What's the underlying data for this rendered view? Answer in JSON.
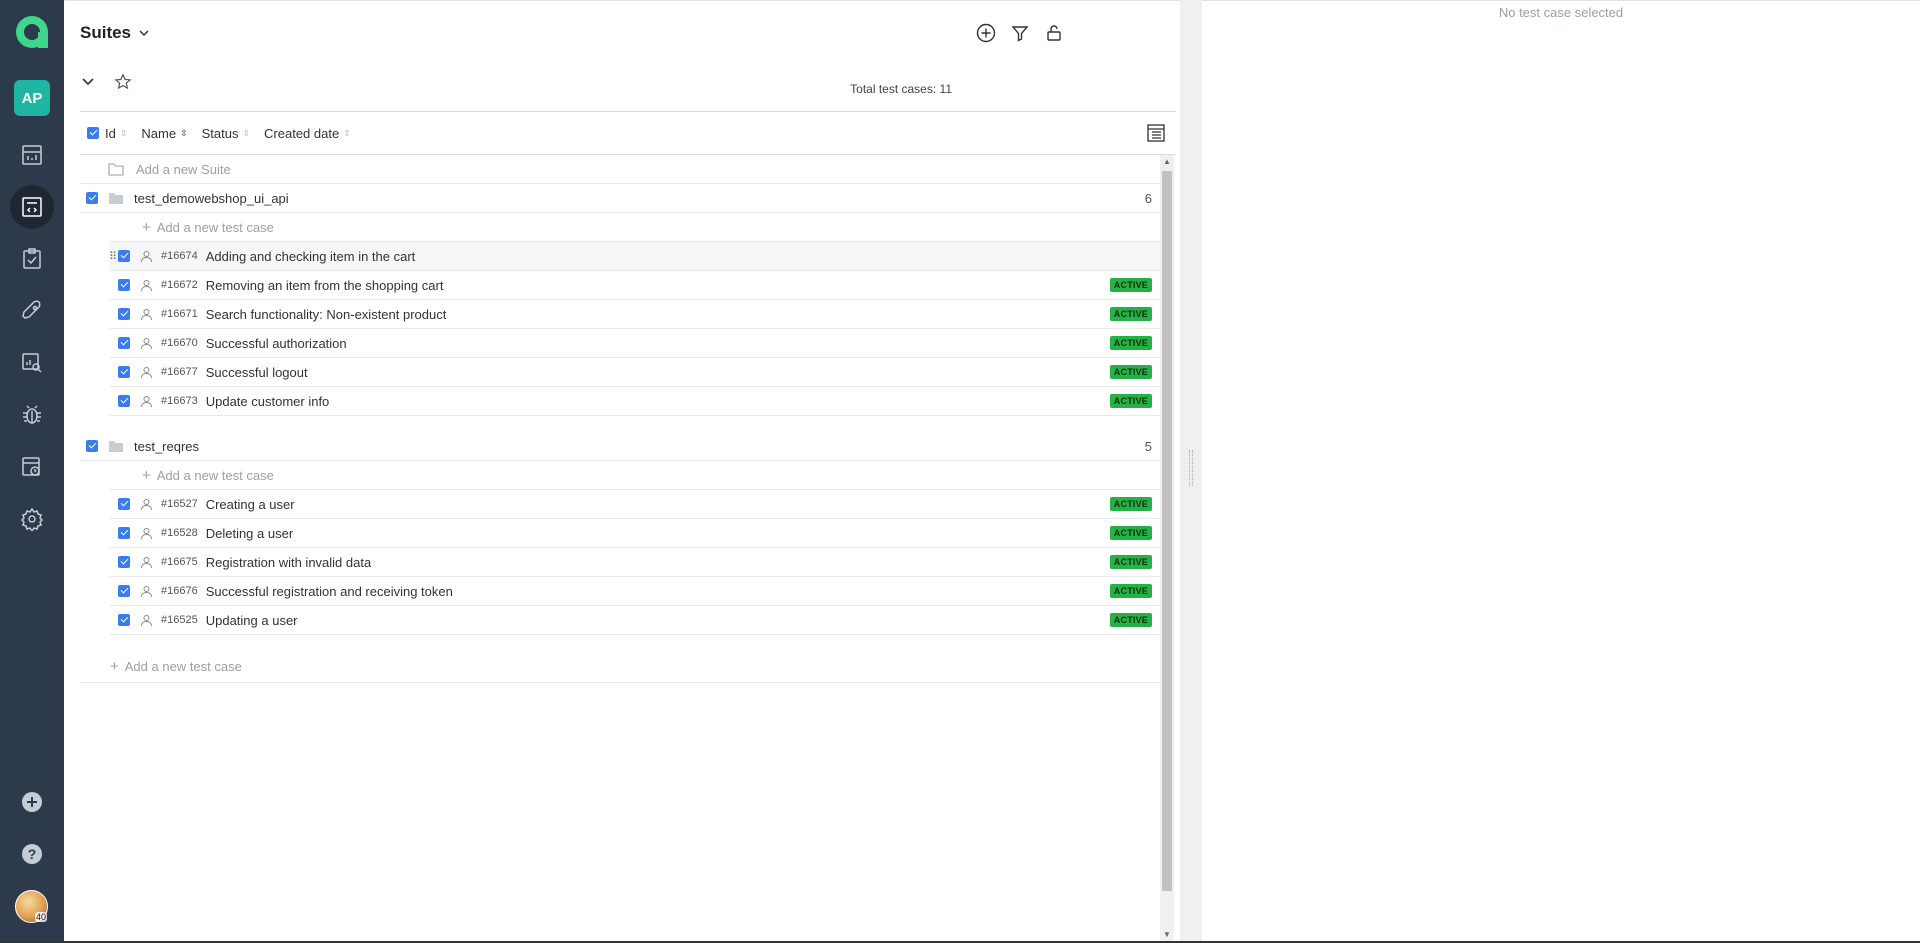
{
  "sidebar": {
    "avatar_initials": "AP",
    "user_photo_label": "40",
    "items": [
      {
        "icon": "dashboard-icon"
      },
      {
        "icon": "repository-icon"
      },
      {
        "icon": "test-plans-icon"
      },
      {
        "icon": "launches-icon"
      },
      {
        "icon": "analytics-icon"
      },
      {
        "icon": "defects-icon"
      },
      {
        "icon": "environments-icon"
      },
      {
        "icon": "settings-icon"
      }
    ],
    "active_item": "repository-icon"
  },
  "header": {
    "title": "Suites",
    "total_label": "Total test cases:",
    "total_count": "11"
  },
  "columns": {
    "id": "Id",
    "name": "Name",
    "status": "Status",
    "created": "Created date"
  },
  "add_suite_label": "Add a new Suite",
  "add_case_label": "Add a new test case",
  "suites": [
    {
      "name": "test_demowebshop_ui_api",
      "count": "6",
      "cases": [
        {
          "id": "#16674",
          "title": "Adding and checking item in the cart",
          "status": ""
        },
        {
          "id": "#16672",
          "title": "Removing an item from the shopping cart",
          "status": "ACTIVE"
        },
        {
          "id": "#16671",
          "title": "Search functionality: Non-existent product",
          "status": "ACTIVE"
        },
        {
          "id": "#16670",
          "title": "Successful authorization",
          "status": "ACTIVE"
        },
        {
          "id": "#16677",
          "title": "Successful logout",
          "status": "ACTIVE"
        },
        {
          "id": "#16673",
          "title": "Update customer info",
          "status": "ACTIVE"
        }
      ]
    },
    {
      "name": "test_reqres",
      "count": "5",
      "cases": [
        {
          "id": "#16527",
          "title": "Creating a user",
          "status": "ACTIVE"
        },
        {
          "id": "#16528",
          "title": "Deleting a user",
          "status": "ACTIVE"
        },
        {
          "id": "#16675",
          "title": "Registration with invalid data",
          "status": "ACTIVE"
        },
        {
          "id": "#16676",
          "title": "Successful registration and receiving token",
          "status": "ACTIVE"
        },
        {
          "id": "#16525",
          "title": "Updating a user",
          "status": "ACTIVE"
        }
      ]
    }
  ],
  "detail": {
    "empty_message": "No test case selected"
  },
  "colors": {
    "sidebar_bg": "#2d3a4b",
    "accent": "#3b7cf0",
    "active_badge": "#25b245",
    "avatar_bg": "#1fb5a4"
  }
}
